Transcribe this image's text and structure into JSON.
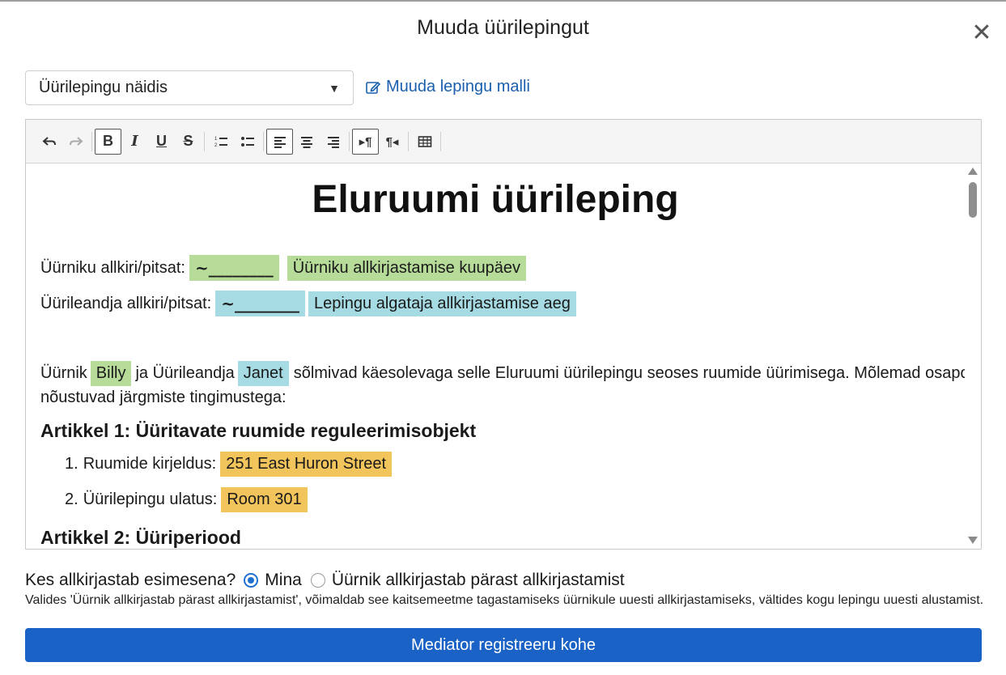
{
  "modal": {
    "title": "Muuda üürilepingut",
    "close_glyph": "✕"
  },
  "template_select": {
    "value": "Üürilepingu näidis",
    "chevron": "⌄"
  },
  "edit_template_link": {
    "label": "Muuda lepingu malli"
  },
  "toolbar": {
    "buttons": [
      "undo-icon",
      "redo-icon",
      "bold-icon",
      "italic-icon",
      "underline-icon",
      "strikethrough-icon",
      "ordered-list-icon",
      "unordered-list-icon",
      "align-left-icon",
      "align-center-icon",
      "align-right-icon",
      "ltr-icon",
      "rtl-icon",
      "table-icon"
    ],
    "bold": "B",
    "italic": "I",
    "underline": "U",
    "strike": "S"
  },
  "document": {
    "title": "Eluruumi üürileping",
    "tenant_sig_label": "Üürniku allkiri/pitsat:",
    "tenant_sig_field": "~________",
    "tenant_date_field": "Üürniku allkirjastamise kuupäev",
    "landlord_sig_label": "Üürileandja allkiri/pitsat:",
    "landlord_sig_field": "~________",
    "landlord_time_field": "Lepingu algataja allkirjastamise aeg",
    "intro_1": "Üürnik",
    "tenant_name": "Billy",
    "intro_2": "ja Üürileandja",
    "landlord_name": "Janet",
    "intro_3": "sõlmivad käesolevaga selle Eluruumi üürilepingu seoses ruumide üürimisega. Mõlemad osapooled",
    "intro_4": "nõustuvad järgmiste tingimustega:",
    "article1": "Artikkel 1: Üüritavate ruumide reguleerimisobjekt",
    "item1_num": "1.",
    "item1_label": "Ruumide kirjeldus:",
    "item1_value": "251 East Huron Street",
    "item2_num": "2.",
    "item2_label": "Üürilepingu ulatus:",
    "item2_value": "Room 301",
    "article2": "Artikkel 2: Üüriperiood"
  },
  "highlight_colors": {
    "tenant": "#b7dc9a",
    "landlord": "#a6dbe3",
    "field": "#f2c45c"
  },
  "signing": {
    "question": "Kes allkirjastab esimesena?",
    "option_me": "Mina",
    "option_tenant": "Üürnik allkirjastab pärast allkirjastamist",
    "selected": "Mina",
    "helper": "Valides 'Üürnik allkirjastab pärast allkirjastamist', võimaldab see kaitsemeetme tagastamiseks üürnikule uuesti allkirjastamiseks, vältides kogu lepingu uuesti alustamist."
  },
  "submit": {
    "label": "Mediator registreeru kohe",
    "color": "#1a62c5"
  }
}
